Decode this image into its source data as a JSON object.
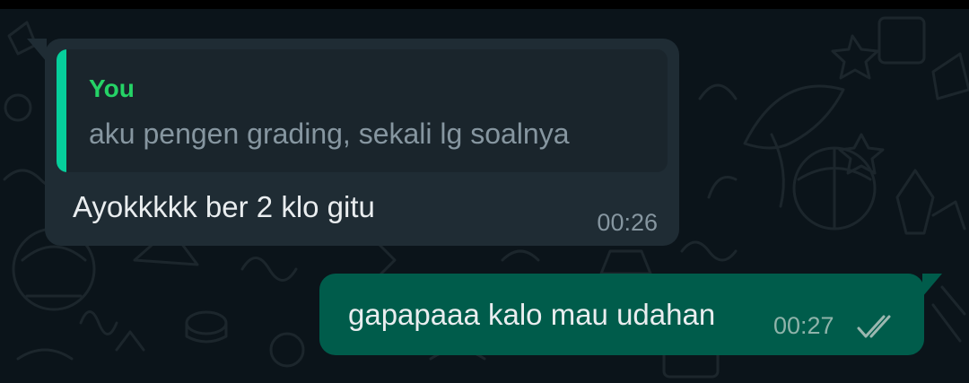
{
  "conversation": {
    "incoming": {
      "quote": {
        "author": "You",
        "text": "aku pengen grading, sekali lg soalnya"
      },
      "text": "Ayokkkkk ber 2 klo gitu",
      "time": "00:26"
    },
    "outgoing": {
      "text": "gapapaaa kalo mau udahan",
      "time": "00:27",
      "status_icon": "double-check-icon"
    }
  },
  "theme": {
    "background": "#0b141a",
    "incoming_bubble": "#1f2c34",
    "outgoing_bubble": "#005c4b",
    "quote_accent": "#06cf9c",
    "quote_author": "#25d366",
    "text": "#e9edef",
    "meta_text": "#8696a0"
  }
}
